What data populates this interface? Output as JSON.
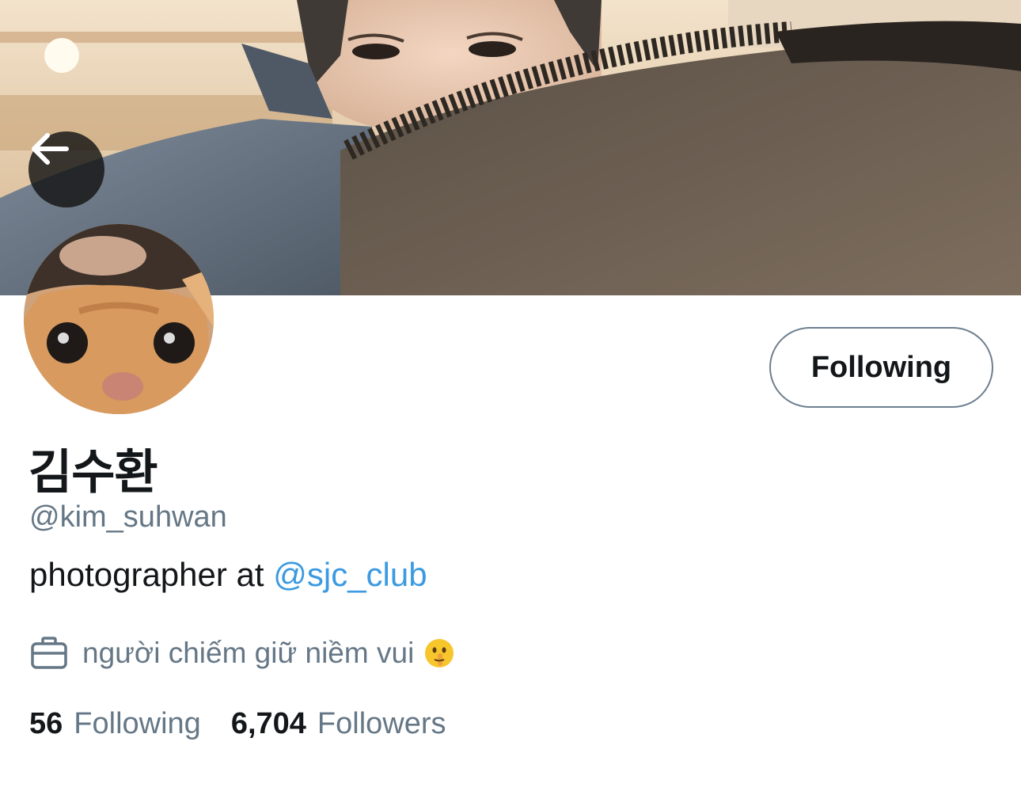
{
  "profile": {
    "display_name": "김수환",
    "handle": "@kim_suhwan",
    "bio_text": "photographer at ",
    "bio_mention": "@sjc_club",
    "occupation": "người chiếm giữ niềm vui",
    "occupation_emoji": "shushing-face-icon"
  },
  "actions": {
    "follow_label": "Following"
  },
  "stats": {
    "following_count": "56",
    "following_label": "Following",
    "followers_count": "6,704",
    "followers_label": "Followers"
  },
  "colors": {
    "text": "#14171a",
    "muted": "#657786",
    "link": "#3b9ae1",
    "button_border": "#6e7f8f"
  }
}
